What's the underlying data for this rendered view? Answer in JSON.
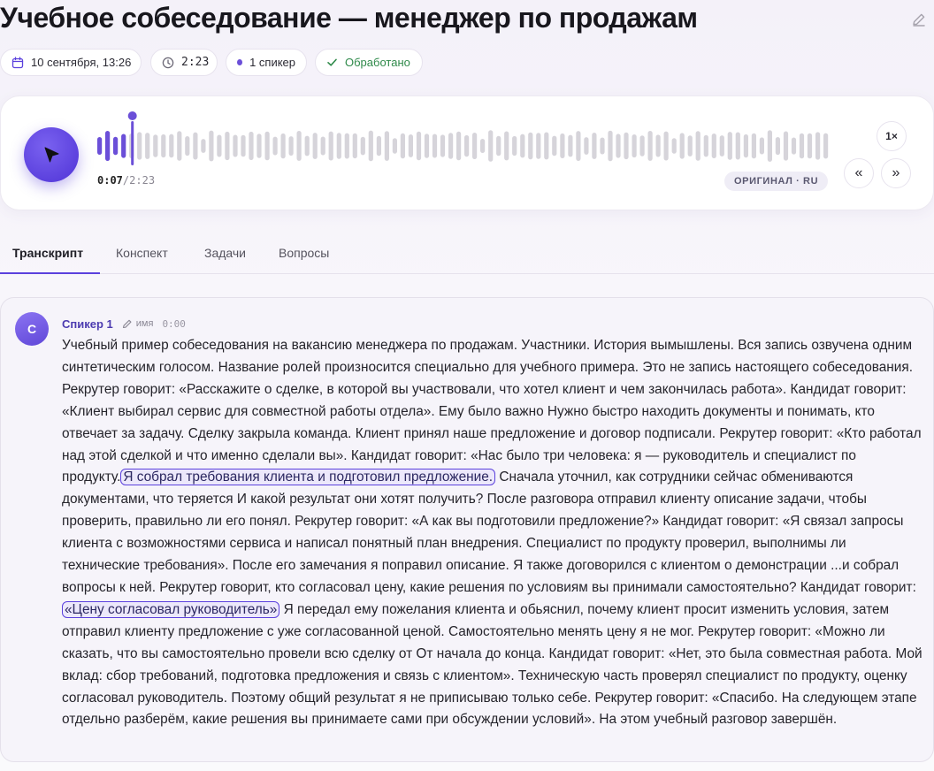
{
  "header": {
    "title": "Учебное собеседование — менеджер по продажам",
    "date": "10 сентября, 13:26",
    "duration": "2:23",
    "speakers": "1 спикер",
    "status": "Обработано",
    "icons": [
      "edit-icon",
      "calendar-icon",
      "clock-icon",
      "check-icon"
    ]
  },
  "player": {
    "current_time": "0:07",
    "separator": "/",
    "total_time": "2:23",
    "progress_fraction": 0.049,
    "language_badge": "ОРИГИНАЛ · RU",
    "speed": "1×",
    "rewind_label": "«",
    "forward_label": "»"
  },
  "tabs": [
    {
      "label": "Транскрипт",
      "active": true
    },
    {
      "label": "Конспект",
      "active": false
    },
    {
      "label": "Задачи",
      "active": false
    },
    {
      "label": "Вопросы",
      "active": false
    }
  ],
  "segment": {
    "avatar_letter": "С",
    "speaker_name": "Спикер 1",
    "rename_label": "имя",
    "timestamp": "0:00",
    "text_1": "Учебный пример собеседования на вакансию менеджера по продажам. Участники. История вымышлены. Вся запись озвучена одним синтетическим голосом. Название ролей произносится специально для учебного примера. Это не запись настоящего собеседования. Рекрутер говорит: «Расскажите о сделке, в которой вы участвовали, что хотел клиент и чем закончилась работа». Кандидат говорит: «Клиент выбирал сервис для совместной работы отдела». Ему было важно Нужно быстро находить документы и понимать, кто отвечает за задачу. Сделку закрыла команда. Клиент принял наше предложение и договор подписали. Рекрутер говорит: «Кто работал над этой сделкой и что именно сделали вы». Кандидат говорит: «Нас было три человека: я — руководитель и специалист по продукту.",
    "highlight_1": "Я собрал требования клиента и подготовил предложение.",
    "text_2": " Сначала уточнил, как сотрудники сейчас обмениваются документами, что теряется И какой результат они хотят получить? После разговора отправил клиенту описание задачи, чтобы проверить, правильно ли его понял. Рекрутер говорит: «А как вы подготовили предложение?» Кандидат говорит: «Я связал запросы клиента с возможностями сервиса и написал понятный план внедрения. Специалист по продукту проверил, выполнимы ли технические требования». После его замечания я поправил описание. Я также договорился с клиентом о демонстрации ...и собрал вопросы к ней. Рекрутер говорит, кто согласовал цену, какие решения по условиям вы принимали самостоятельно? Кандидат говорит: ",
    "highlight_2": "«Цену согласовал руководитель»",
    "text_3": " Я передал ему пожелания клиента и обьяснил, почему клиент просит изменить условия, затем отправил клиенту предложение с уже согласованной ценой. Самостоятельно менять цену я не мог. Рекрутер говорит: «Можно ли сказать, что вы самостоятельно провели всю сделку от От начала до конца. Кандидат говорит: «Нет, это была совместная работа. Мой вклад: сбор требований, подготовка предложения и связь с клиентом». Техническую часть проверял специалист по продукту, оценку согласовал руководитель. Поэтому общий результат я не приписываю только себе. Рекрутер говорит: «Спасибо. На следующем этапе отдельно разберём, какие решения вы принимаете сами при обсуждении условий». На этом учебный разговор завершён."
  },
  "colors": {
    "accent": "#5b41dd",
    "played_bar": "#6b4fd8",
    "unplayed_bar": "#d6d4da",
    "status_green": "#2f8a4a"
  }
}
